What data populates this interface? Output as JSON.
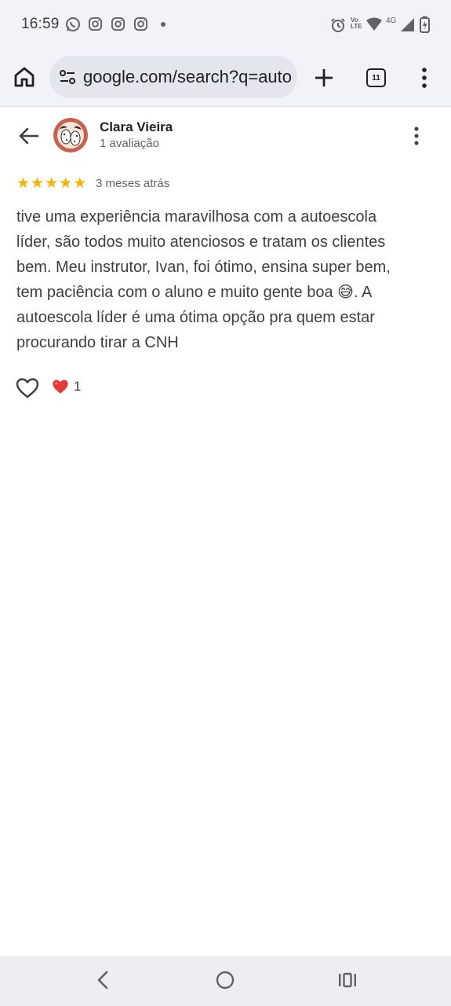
{
  "status_bar": {
    "time": "16:59",
    "left_icons": [
      "whatsapp-icon",
      "instagram-icon",
      "instagram-icon",
      "instagram-icon",
      "dot-icon"
    ],
    "network_label": "4G",
    "volte_label": "Vo LTE",
    "right_icons": [
      "alarm-icon",
      "volte-icon",
      "wifi-icon",
      "signal-icon",
      "battery-charging-icon"
    ]
  },
  "toolbar": {
    "url": "google.com/search?q=auto",
    "tab_count": "11",
    "icons": [
      "home-icon",
      "site-settings-icon",
      "new-tab-icon",
      "tab-switcher-icon",
      "more-vert-icon"
    ]
  },
  "review": {
    "author": "Clara Vieira",
    "author_reviews": "1 avaliação",
    "rating": 5,
    "date": "3 meses atrás",
    "text_lines": [
      "tive uma experiência maravilhosa com a autoescola",
      "líder, são todos muito atenciosos e tratam os clientes",
      "bem. Meu instrutor, Ivan, foi ótimo, ensina super bem,",
      "tem paciência com o aluno e muito gente boa 😅. A",
      "autoescola líder é uma ótima opção pra quem estar",
      "procurando tirar a CNH"
    ],
    "reaction_count": "1"
  },
  "colors": {
    "star": "#f4b400",
    "heart": "#e53935",
    "toolbar_bg": "#f1f3f8"
  }
}
